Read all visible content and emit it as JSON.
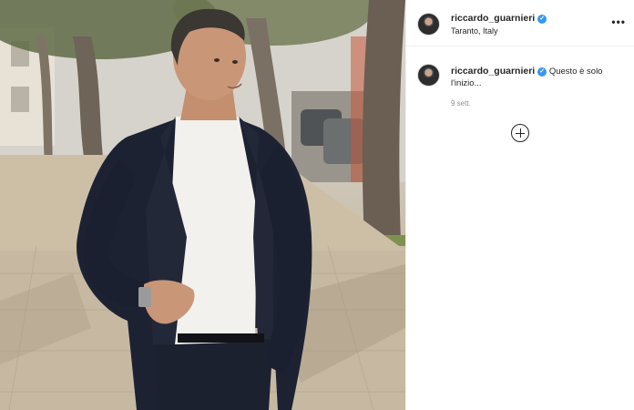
{
  "header": {
    "username": "riccardo_guarnieri",
    "location": "Taranto, Italy",
    "more_icon": "more-options-icon",
    "more_glyph": "•••"
  },
  "caption": {
    "username": "riccardo_guarnieri",
    "text": "Questo è solo l'inizio...",
    "date": "9 sett."
  },
  "icons": {
    "verified": "verified-badge-icon",
    "load_more": "plus-circle-icon"
  },
  "colors": {
    "verified": "#3897f0",
    "text": "#262626",
    "muted": "#8e8e8e",
    "divider": "#efefef"
  }
}
